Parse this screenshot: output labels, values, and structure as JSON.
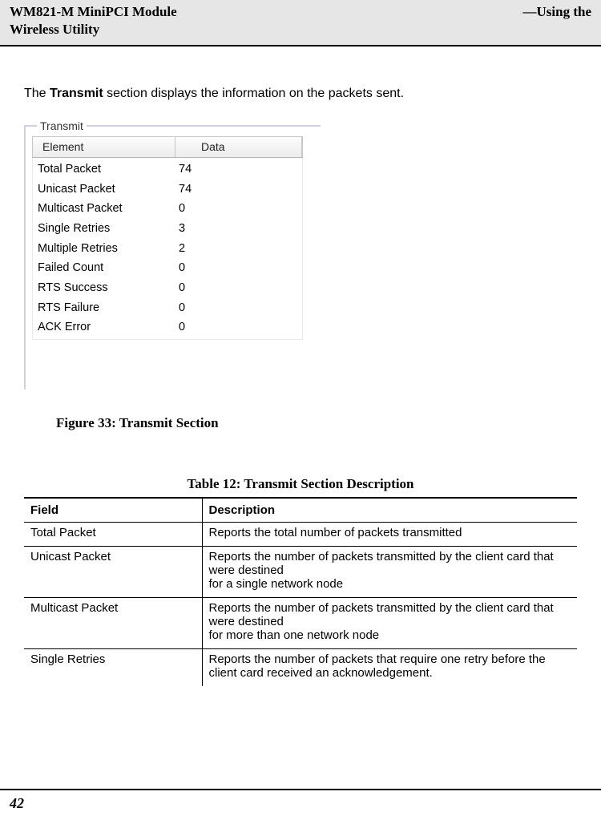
{
  "header": {
    "left_line1": "WM821-M MiniPCI Module",
    "left_line2": "Wireless Utility",
    "right_line1": "—Using the",
    "right_line2": ""
  },
  "intro": {
    "prefix": "The ",
    "bold": "Transmit",
    "suffix": " section displays the information on the packets sent."
  },
  "transmit_panel": {
    "legend": "Transmit",
    "col_element": "Element",
    "col_data": "Data",
    "rows": [
      {
        "element": "Total Packet",
        "data": "74"
      },
      {
        "element": "Unicast Packet",
        "data": "74"
      },
      {
        "element": "Multicast Packet",
        "data": "0"
      },
      {
        "element": "Single Retries",
        "data": "3"
      },
      {
        "element": "Multiple Retries",
        "data": "2"
      },
      {
        "element": "Failed Count",
        "data": "0"
      },
      {
        "element": "RTS Success",
        "data": "0"
      },
      {
        "element": "RTS Failure",
        "data": "0"
      },
      {
        "element": "ACK Error",
        "data": "0"
      }
    ]
  },
  "figure_caption": {
    "label": "Figure 33: ",
    "title": "Transmit Section"
  },
  "table_caption": {
    "label": "Table 12: ",
    "title": "Transmit Section Description"
  },
  "desc_table": {
    "col_field": "Field",
    "col_desc": "Description",
    "rows": [
      {
        "field": "Total Packet",
        "desc": "Reports the total number of packets transmitted"
      },
      {
        "field": "Unicast Packet",
        "desc": "Reports the number of packets transmitted by the client card that were destined\nfor a single network node"
      },
      {
        "field": "Multicast Packet",
        "desc": "Reports the number of packets transmitted by the client card that were destined\nfor more than one network node"
      },
      {
        "field": "Single Retries",
        "desc": "Reports the number of packets that require one retry before the client card received an acknowledgement."
      }
    ]
  },
  "page_number": "42"
}
